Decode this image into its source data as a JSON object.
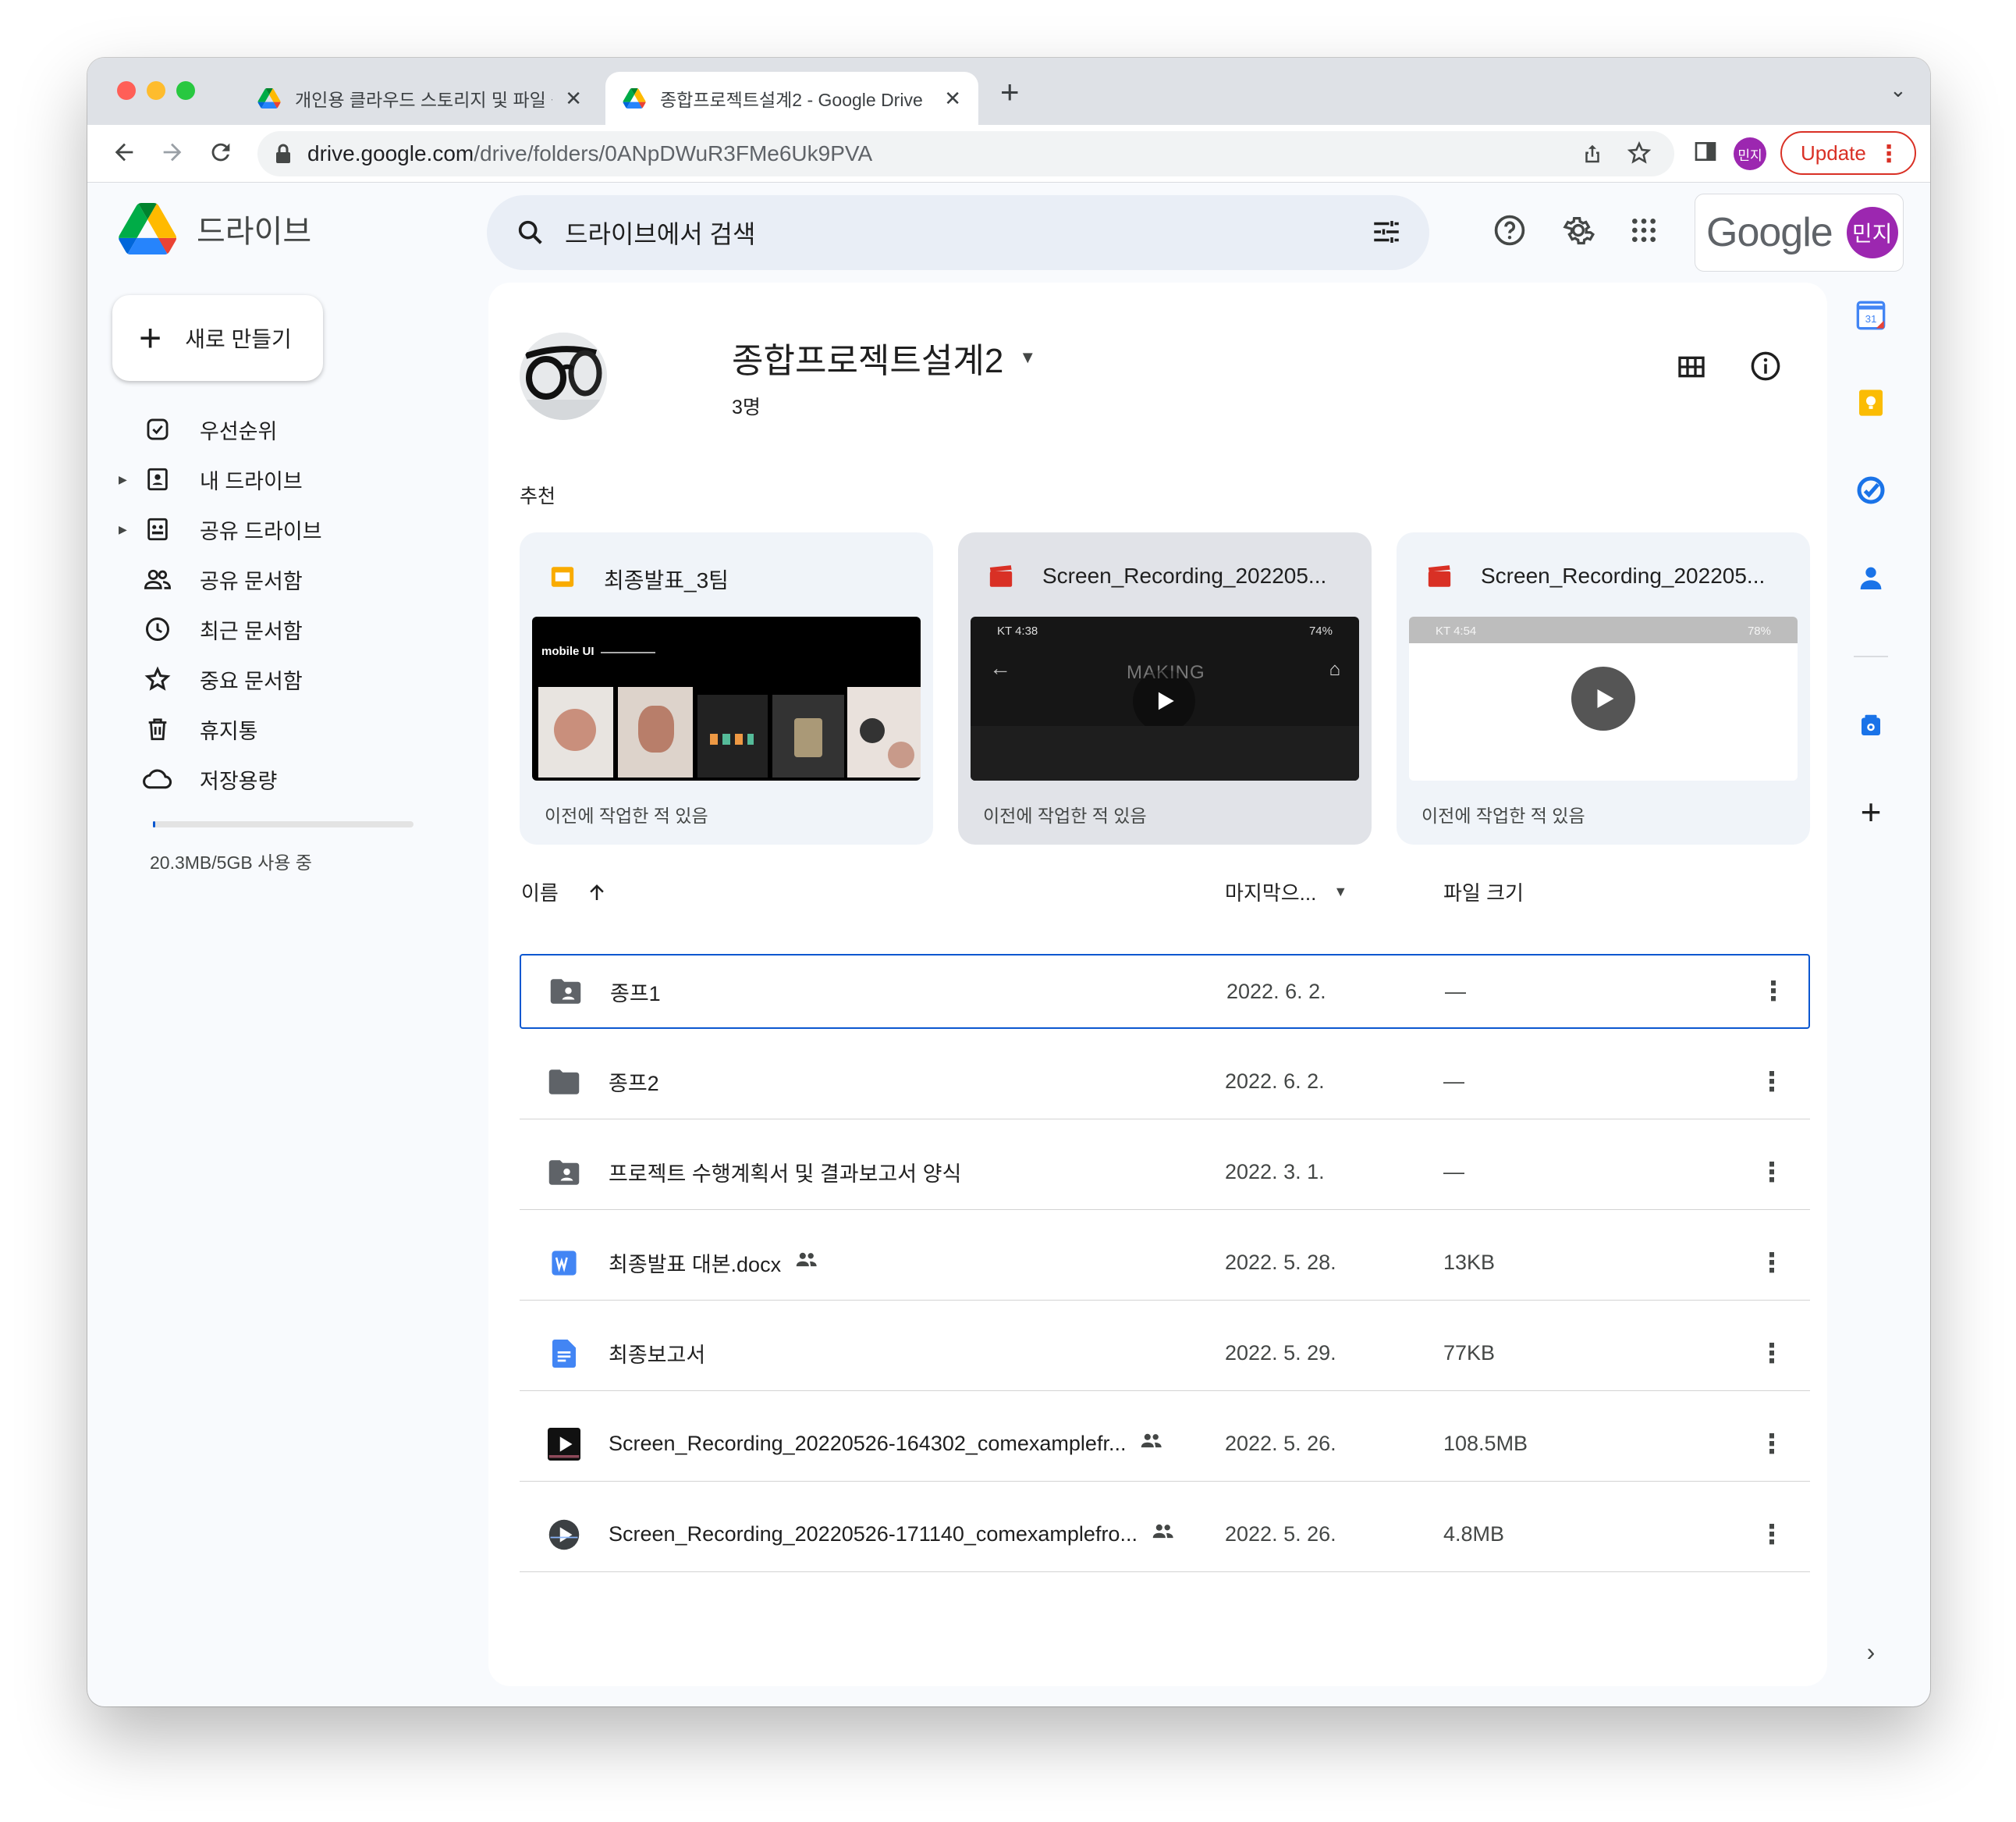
{
  "browser": {
    "tabs": [
      {
        "title": "개인용 클라우드 스토리지 및 파일 공"
      },
      {
        "title": "종합프로젝트설계2 - Google Drive"
      }
    ],
    "url_host": "drive.google.com",
    "url_path": "/drive/folders/0ANpDWuR3FMe6Uk9PVA",
    "profile_initials": "민지",
    "update_label": "Update"
  },
  "drive": {
    "product_name": "드라이브",
    "search_placeholder": "드라이브에서 검색",
    "google_label": "Google",
    "account_initials": "민지"
  },
  "sidebar": {
    "new_label": "새로 만들기",
    "items": [
      {
        "label": "우선순위",
        "icon": "priority-icon"
      },
      {
        "label": "내 드라이브",
        "icon": "my-drive-icon"
      },
      {
        "label": "공유 드라이브",
        "icon": "shared-drives-icon"
      },
      {
        "label": "공유 문서함",
        "icon": "shared-with-me-icon"
      },
      {
        "label": "최근 문서함",
        "icon": "recent-icon"
      },
      {
        "label": "중요 문서함",
        "icon": "starred-icon"
      },
      {
        "label": "휴지통",
        "icon": "trash-icon"
      },
      {
        "label": "저장용량",
        "icon": "storage-icon"
      }
    ],
    "storage_used_fraction": 0.004,
    "storage_text": "20.3MB/5GB 사용 중"
  },
  "folder": {
    "title": "종합프로젝트설계2",
    "members": "3명"
  },
  "suggested": {
    "label": "추천",
    "cards": [
      {
        "title": "최종발표_3팀",
        "type": "slides",
        "footer": "이전에 작업한 적 있음",
        "preview_header": "mobile UI"
      },
      {
        "title": "Screen_Recording_202205...",
        "type": "video",
        "footer": "이전에 작업한 적 있음",
        "status_time": "KT 4:38",
        "battery": "74%",
        "overlay": "MAKING"
      },
      {
        "title": "Screen_Recording_202205...",
        "type": "video",
        "footer": "이전에 작업한 적 있음",
        "status_time": "KT 4:54",
        "battery": "78%"
      }
    ]
  },
  "columns": {
    "name": "이름",
    "modified": "마지막으...",
    "size": "파일 크기"
  },
  "files": [
    {
      "name": "종프1",
      "icon": "shared-folder-icon",
      "date": "2022. 6. 2.",
      "size": "—",
      "shared": false
    },
    {
      "name": "종프2",
      "icon": "folder-icon",
      "date": "2022. 6. 2.",
      "size": "—",
      "shared": false
    },
    {
      "name": "프로젝트 수행계획서 및 결과보고서 양식",
      "icon": "shared-folder-icon",
      "date": "2022. 3. 1.",
      "size": "—",
      "shared": false
    },
    {
      "name": "최종발표 대본.docx",
      "icon": "word-icon",
      "date": "2022. 5. 28.",
      "size": "13KB",
      "shared": true
    },
    {
      "name": "최종보고서",
      "icon": "docs-icon",
      "date": "2022. 5. 29.",
      "size": "77KB",
      "shared": false
    },
    {
      "name": "Screen_Recording_20220526-164302_comexamplefr...",
      "icon": "video-thumb-icon",
      "date": "2022. 5. 26.",
      "size": "108.5MB",
      "shared": true
    },
    {
      "name": "Screen_Recording_20220526-171140_comexamplefro...",
      "icon": "video-thumb-icon",
      "date": "2022. 5. 26.",
      "size": "4.8MB",
      "shared": true
    }
  ],
  "rail": {
    "calendar_day": "31"
  },
  "colors": {
    "accent": "#0b57d0",
    "update": "#d93025",
    "avatar": "#9c27b0",
    "search_bg": "#e9eef6",
    "card_bg": "#f0f4f9"
  }
}
